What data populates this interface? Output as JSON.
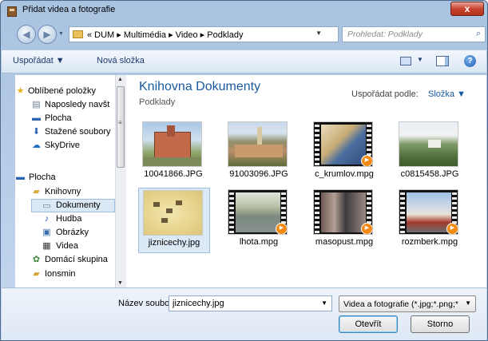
{
  "window": {
    "title": "Přidat videa a fotografie",
    "close_label": "x"
  },
  "address": {
    "path": "« DUM ▸ Multimédia ▸ Video ▸ Podklady",
    "search_placeholder": "Prohledat: Podklady"
  },
  "toolbar": {
    "organize": "Uspořádat ▼",
    "new_folder": "Nová složka"
  },
  "sidebar": {
    "items": [
      {
        "label": "Oblíbené položky",
        "icon": "star-icon"
      },
      {
        "label": "Naposledy navšt",
        "icon": "recent-places-icon"
      },
      {
        "label": "Plocha",
        "icon": "desktop-icon"
      },
      {
        "label": "Stažené soubory",
        "icon": "downloads-icon"
      },
      {
        "label": "SkyDrive",
        "icon": "skydrive-icon"
      },
      {
        "label": "Plocha",
        "icon": "desktop-icon"
      },
      {
        "label": "Knihovny",
        "icon": "libraries-icon"
      },
      {
        "label": "Dokumenty",
        "icon": "documents-icon"
      },
      {
        "label": "Hudba",
        "icon": "music-icon"
      },
      {
        "label": "Obrázky",
        "icon": "pictures-icon"
      },
      {
        "label": "Videa",
        "icon": "videos-icon"
      },
      {
        "label": "Domácí skupina",
        "icon": "homegroup-icon"
      },
      {
        "label": "Ionsmin",
        "icon": "user-folder-icon"
      }
    ]
  },
  "main": {
    "title": "Knihovna Dokumenty",
    "subtitle": "Podklady",
    "arrange_label": "Uspořádat podle:",
    "arrange_value": "Složka ▼",
    "files": [
      {
        "name": "10041866.JPG",
        "type": "photo"
      },
      {
        "name": "91003096.JPG",
        "type": "photo"
      },
      {
        "name": "c_krumlov.mpg",
        "type": "video"
      },
      {
        "name": "c0815458.JPG",
        "type": "photo"
      },
      {
        "name": "jiznicechy.jpg",
        "type": "photo"
      },
      {
        "name": "lhota.mpg",
        "type": "video"
      },
      {
        "name": "masopust.mpg",
        "type": "video"
      },
      {
        "name": "rozmberk.mpg",
        "type": "video"
      }
    ]
  },
  "bottom": {
    "filename_label": "Název souboru:",
    "filename_value": "jiznicechy.jpg",
    "filetype_value": "Videa a fotografie (*.jpg;*.png;*",
    "open_button": "Otevřít",
    "cancel_button": "Storno"
  },
  "colors": {
    "accent": "#1a5aa0",
    "selection": "#dbe8f6",
    "play_badge": "#f28a13"
  }
}
